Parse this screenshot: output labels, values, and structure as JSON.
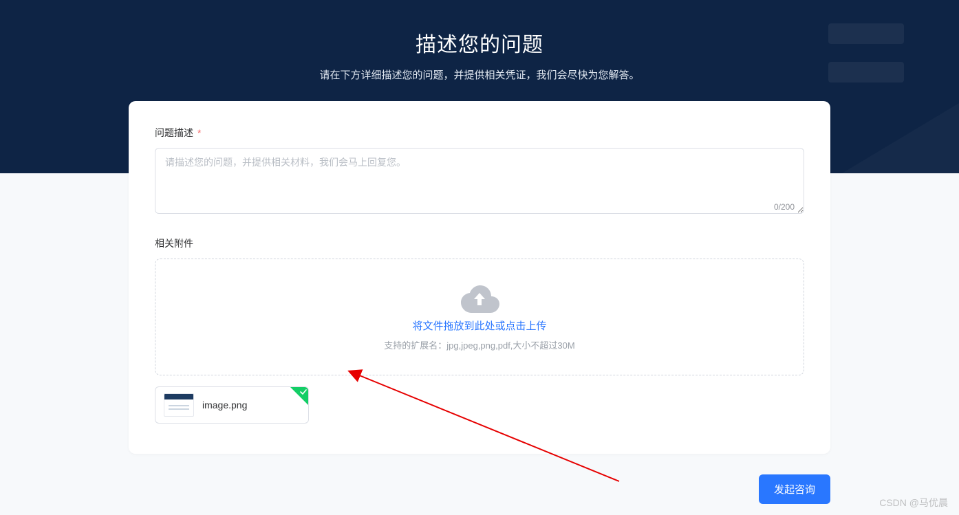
{
  "header": {
    "title": "描述您的问题",
    "subtitle": "请在下方详细描述您的问题，并提供相关凭证，我们会尽快为您解答。"
  },
  "form": {
    "description": {
      "label": "问题描述",
      "required_mark": "*",
      "placeholder": "请描述您的问题，并提供相关材料，我们会马上回复您。",
      "value": "",
      "counter": "0/200"
    },
    "attachment": {
      "label": "相关附件",
      "upload_main": "将文件拖放到此处或点击上传",
      "upload_hint": "支持的扩展名：jpg,jpeg,png,pdf,大小不超过30M",
      "file": {
        "name": "image.png"
      }
    }
  },
  "actions": {
    "submit": "发起咨询"
  },
  "watermark": "CSDN @马优晨"
}
